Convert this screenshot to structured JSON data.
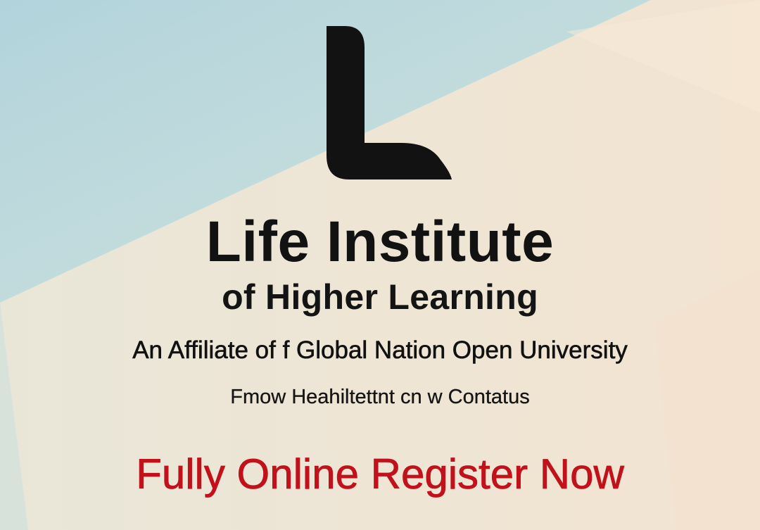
{
  "colors": {
    "background_blue": "#b9d6dc",
    "background_cream": "#f0e4d3",
    "logo": "#121212",
    "heading": "#121212",
    "cta": "#c1121c"
  },
  "logo": {
    "icon": "letter-l-logo-icon"
  },
  "heading": {
    "title_line1": "Life Institute",
    "title_line2": "of Higher Learning"
  },
  "affiliation": "An Affiliate of f Global Nation Open  University",
  "contact_line": "Fmow Heahiltettnt cn w Contatus",
  "cta": "Fully Online Register Now"
}
